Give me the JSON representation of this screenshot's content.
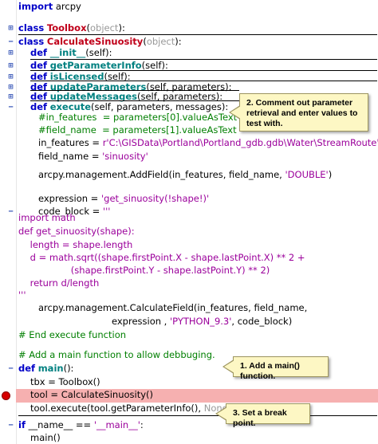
{
  "colors": {
    "keyword": "#0000c8",
    "class_name": "#c0001a",
    "function_name": "#008080",
    "string": "#9b009b",
    "comment": "#007f00",
    "breakpoint_row": "#f6b0b0",
    "breakpoint_dot": "#d60000",
    "callout_bg": "#fdf7c4"
  },
  "icons": {
    "fold_collapsed": "plus-square-icon",
    "fold_expanded": "minus-line-icon",
    "breakpoint": "breakpoint-icon"
  },
  "code": {
    "l1": {
      "kw": "import",
      "rest": " arcpy"
    },
    "l2": {
      "kw": "class",
      "name": "Toolbox",
      "open": "(",
      "base": "object",
      "close": "):"
    },
    "l3": {
      "kw": "class",
      "name": "CalculateSinuosity",
      "open": "(",
      "base": "object",
      "close": "):"
    },
    "l4": {
      "kw": "def",
      "name": "__init__",
      "args": "(self):"
    },
    "l5": {
      "kw": "def",
      "name": "getParameterInfo",
      "args": "(self):"
    },
    "l6": {
      "kw": "def",
      "name": "isLicensed",
      "args": "(self):"
    },
    "l7": {
      "kw": "def",
      "name": "updateParameters",
      "args": "(self, parameters):"
    },
    "l8": {
      "kw": "def",
      "name": "updateMessages",
      "args": "(self, parameters):"
    },
    "l9": {
      "kw": "def",
      "name": "execute",
      "args": "(self, parameters, messages):"
    },
    "l10": "#in_features  = parameters[0].valueAsText",
    "l11": "#field_name  = parameters[1].valueAsText",
    "l12": {
      "pre": "in_features = ",
      "str": "r'C:\\GISData\\Portland\\Portland_gdb.gdb\\Water\\StreamRoute'"
    },
    "l13": {
      "pre": "field_name = ",
      "str": "'sinuosity'"
    },
    "l14": {
      "pre": "arcpy.management.AddField(in_features, field_name, ",
      "str": "'DOUBLE'",
      "post": ")"
    },
    "l15": {
      "pre": "expression = ",
      "str": "'get_sinuosity(!shape!)'"
    },
    "l16": {
      "pre": "code_block = ",
      "str": "'''"
    },
    "l17": "import math",
    "l18": "def get_sinuosity(shape):",
    "l19": "    length = shape.length",
    "l20": "    d = math.sqrt((shape.firstPoint.X - shape.lastPoint.X) ** 2 +",
    "l21": "                  (shape.firstPoint.Y - shape.lastPoint.Y) ** 2)",
    "l22": "    return d/length",
    "l23": "'''",
    "l24": "arcpy.management.CalculateField(in_features, field_name,",
    "l25": {
      "pre": "expression , ",
      "str": "'PYTHON_9.3'",
      "post": ", code_block)"
    },
    "l26": "# End execute function",
    "l27": "# Add a main function to allow debbuging.",
    "l28": {
      "kw": "def",
      "name": "main",
      "args": "():"
    },
    "l29": "tbx = Toolbox()",
    "l30": "tool = CalculateSinuosity()",
    "l31": {
      "pre": "tool.execute(tool.getParameterInfo(), ",
      "bi": "None",
      "post": ")"
    },
    "l32": {
      "kw": "if",
      "mid": " __name__ == ",
      "str": "'__main__'",
      "post": ":"
    },
    "l33": "main()"
  },
  "callouts": {
    "c2": "2. Comment out parameter retrieval and enter values to test with.",
    "c1": "1. Add a main() function.",
    "c3": "3. Set a break point."
  }
}
